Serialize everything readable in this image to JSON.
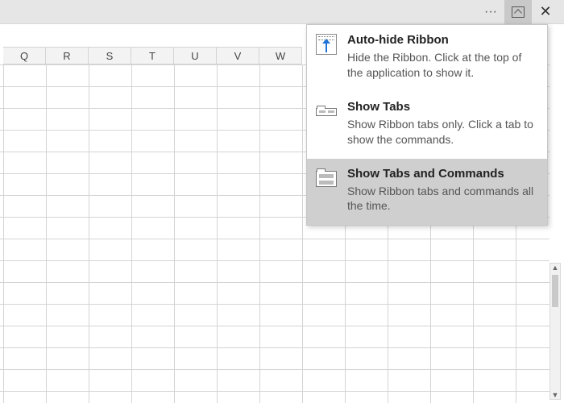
{
  "titlebar": {
    "more_label": "···",
    "close_label": "✕"
  },
  "columns": [
    "Q",
    "R",
    "S",
    "T",
    "U",
    "V",
    "W"
  ],
  "ribbon_menu": {
    "items": [
      {
        "icon": "auto-hide-ribbon-icon",
        "title": "Auto-hide Ribbon",
        "desc": "Hide the Ribbon. Click at the top of the application to show it.",
        "selected": false
      },
      {
        "icon": "show-tabs-icon",
        "title": "Show Tabs",
        "desc": "Show Ribbon tabs only. Click a tab to show the commands.",
        "selected": false
      },
      {
        "icon": "show-tabs-commands-icon",
        "title": "Show Tabs and Commands",
        "desc": "Show Ribbon tabs and commands all the time.",
        "selected": true
      }
    ]
  }
}
